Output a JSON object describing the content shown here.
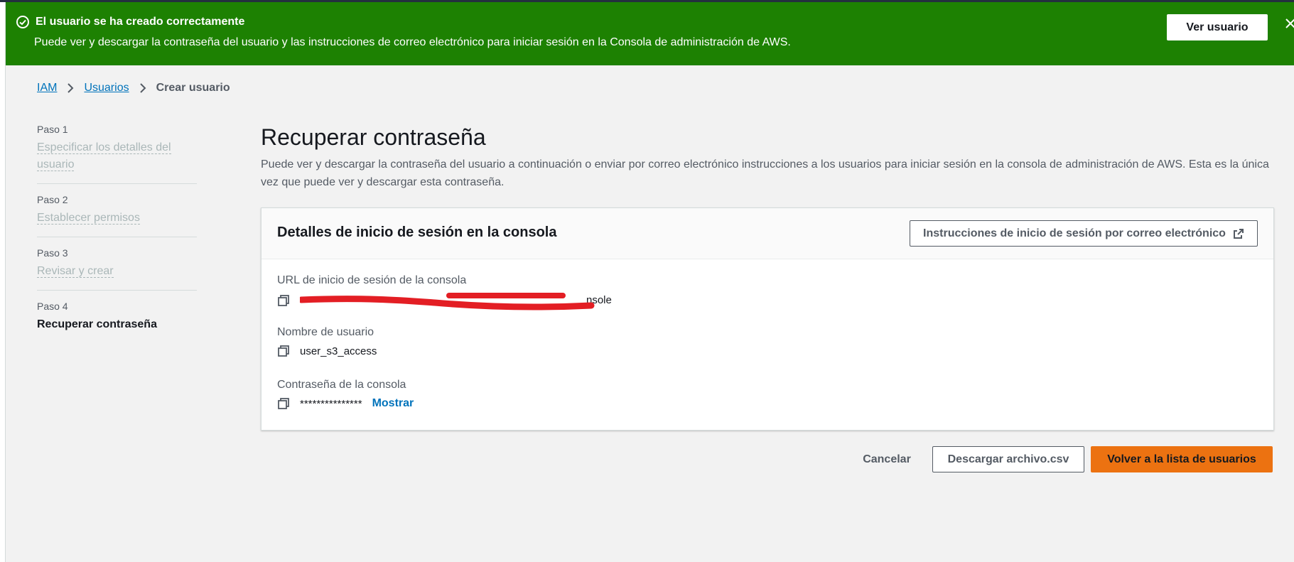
{
  "flash": {
    "title": "El usuario se ha creado correctamente",
    "body": "Puede ver y descargar la contraseña del usuario y las instrucciones de correo electrónico para iniciar sesión en la Consola de administración de AWS.",
    "view_user_label": "Ver usuario",
    "icon": "check-circle-icon",
    "color": "#1d8102"
  },
  "breadcrumb": {
    "items": [
      "IAM",
      "Usuarios"
    ],
    "current": "Crear usuario"
  },
  "steps": [
    {
      "num": "Paso 1",
      "label": "Especificar los detalles del usuario"
    },
    {
      "num": "Paso 2",
      "label": "Establecer permisos"
    },
    {
      "num": "Paso 3",
      "label": "Revisar y crear"
    },
    {
      "num": "Paso 4",
      "label": "Recuperar contraseña"
    }
  ],
  "main": {
    "title": "Recuperar contraseña",
    "description": "Puede ver y descargar la contraseña del usuario a continuación o enviar por correo electrónico instrucciones a los usuarios para iniciar sesión en la consola de administración de AWS. Esta es la única vez que puede ver y descargar esta contraseña."
  },
  "panel": {
    "title": "Detalles de inicio de sesión en la consola",
    "email_instructions_label": "Instrucciones de inicio de sesión por correo electrónico",
    "url_label": "URL de inicio de sesión de la consola",
    "url_value_visible": "nsole",
    "username_label": "Nombre de usuario",
    "username_value": "user_s3_access",
    "password_label": "Contraseña de la consola",
    "password_value": "***************",
    "show_label": "Mostrar"
  },
  "footer": {
    "cancel_label": "Cancelar",
    "csv_label": "Descargar archivo.csv",
    "back_label": "Volver a la lista de usuarios",
    "primary_color": "#ec7211"
  }
}
